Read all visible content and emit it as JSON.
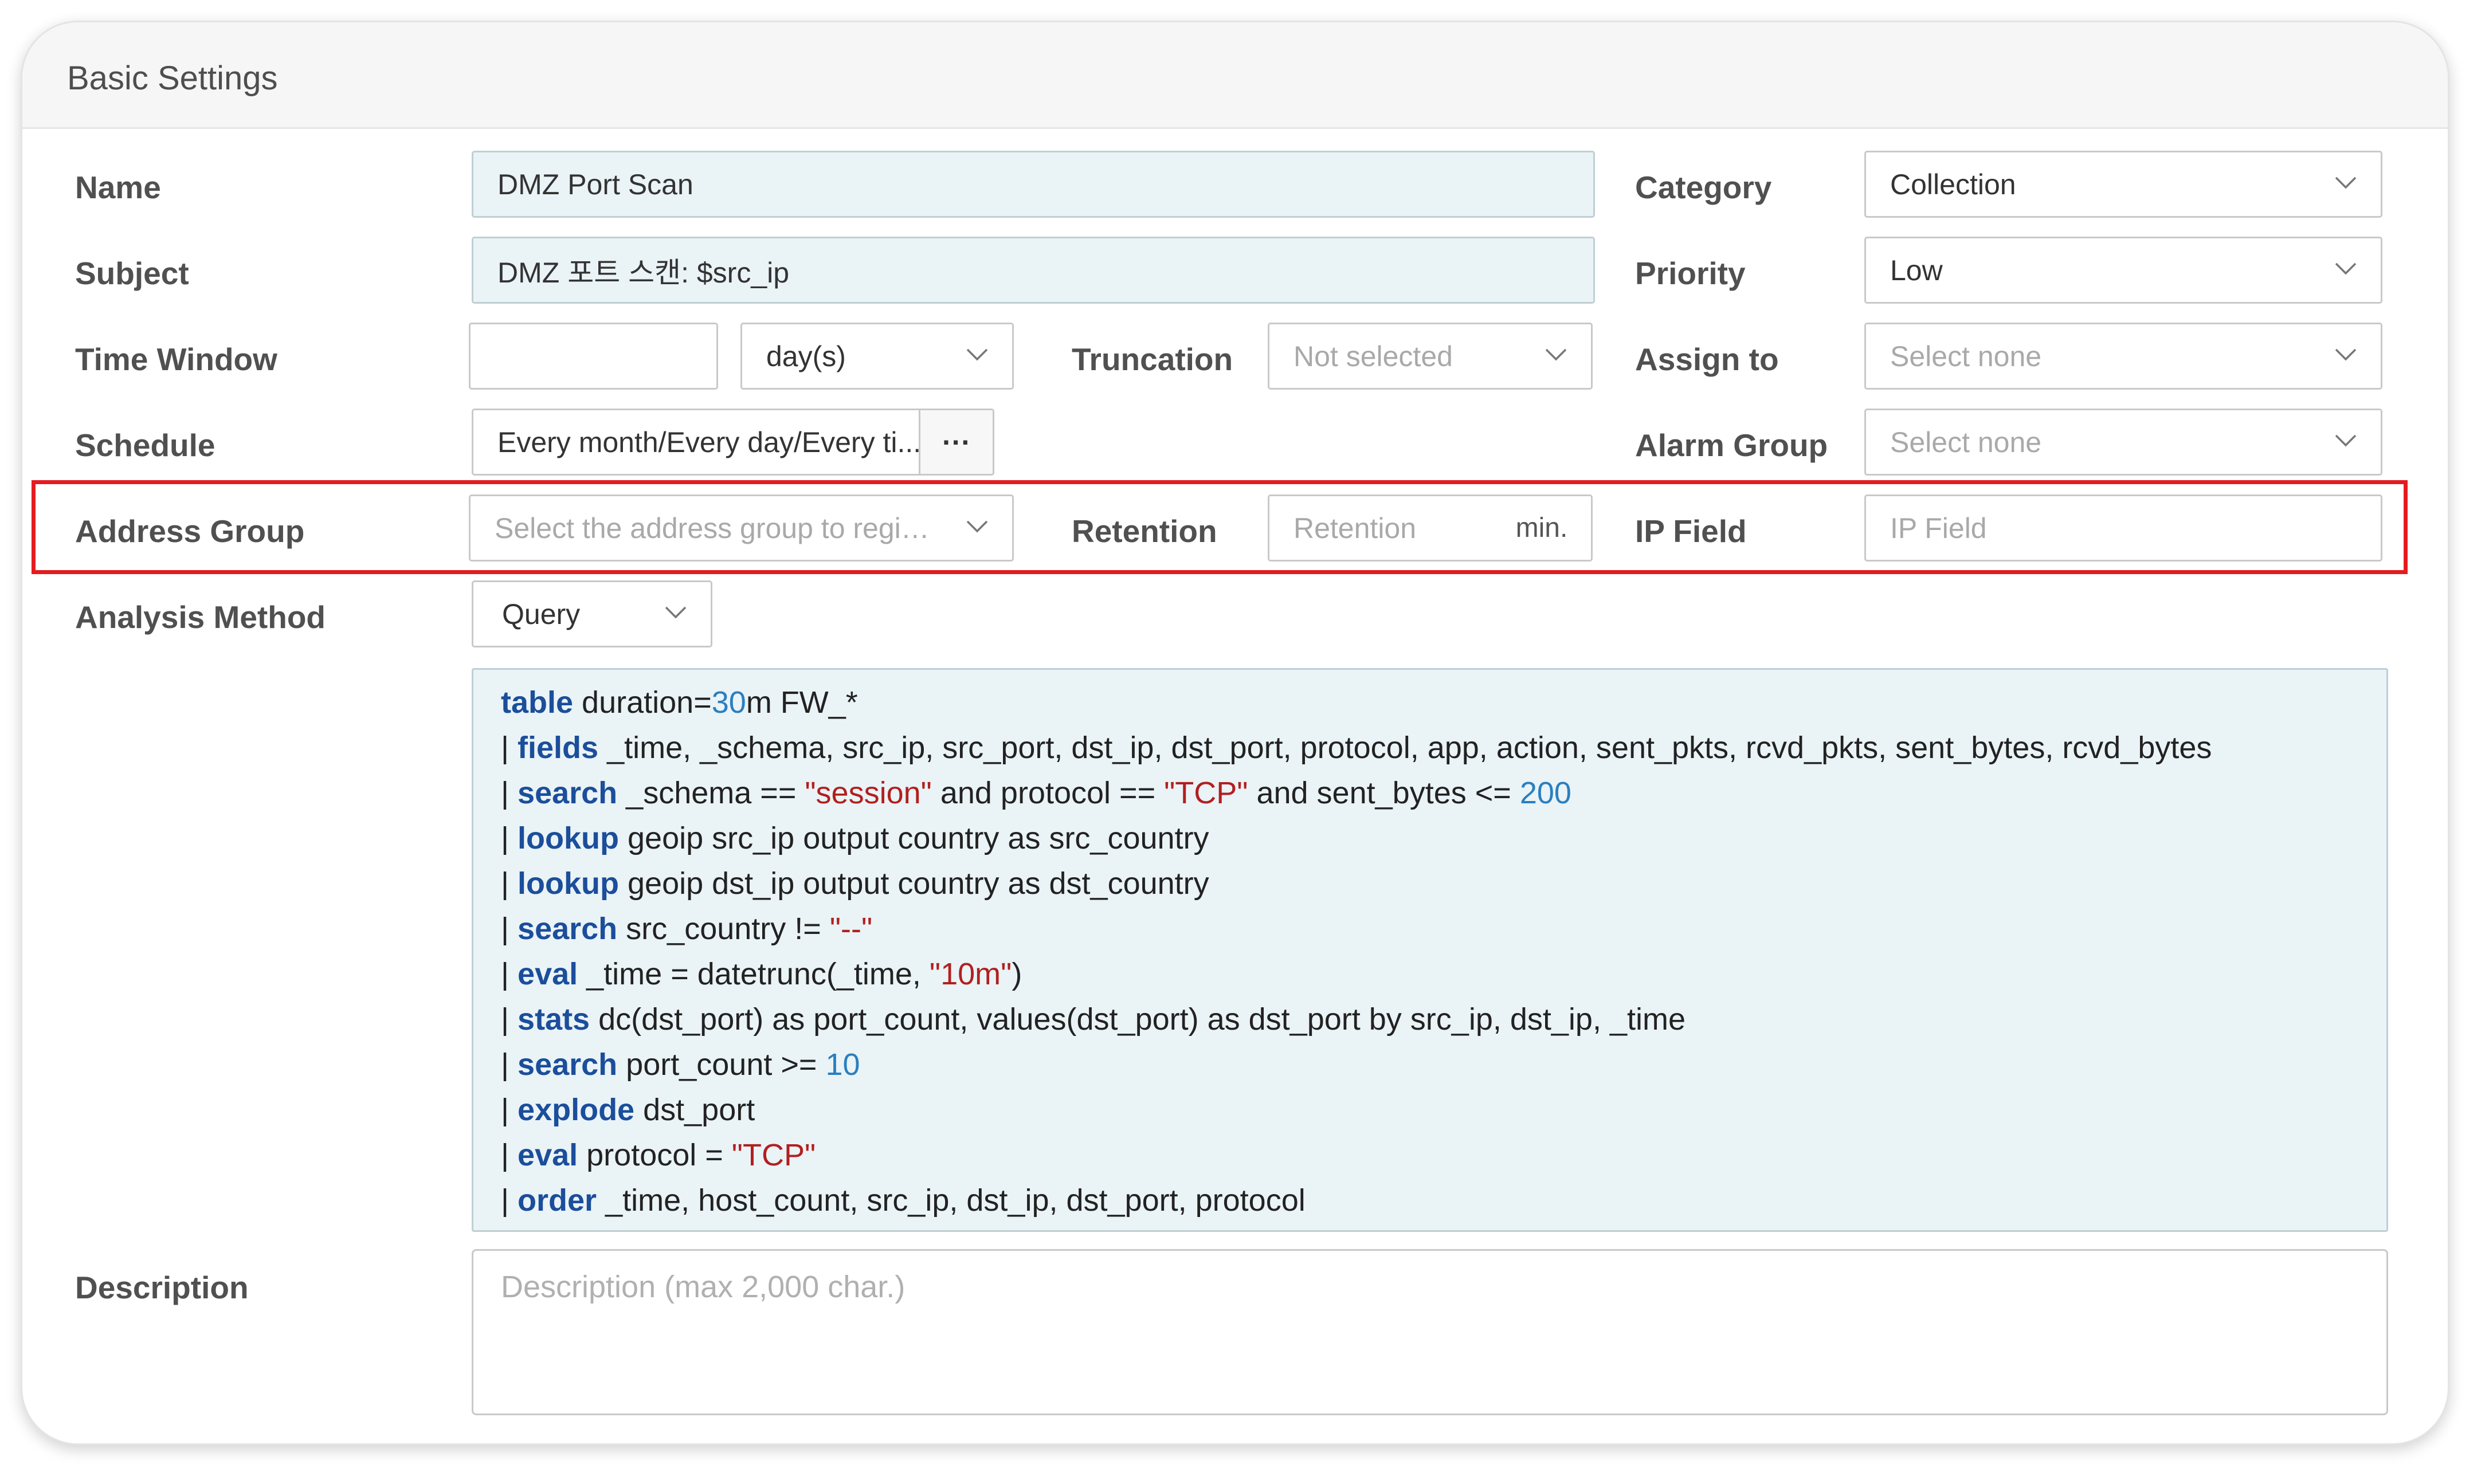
{
  "panel": {
    "title": "Basic Settings"
  },
  "labels": {
    "name": "Name",
    "subject": "Subject",
    "time_window": "Time Window",
    "schedule": "Schedule",
    "address_group": "Address Group",
    "analysis_method": "Analysis Method",
    "description": "Description",
    "truncation": "Truncation",
    "retention": "Retention",
    "category": "Category",
    "priority": "Priority",
    "assign_to": "Assign to",
    "alarm_group": "Alarm Group",
    "ip_field": "IP Field"
  },
  "fields": {
    "name_value": "DMZ Port Scan",
    "subject_value": "DMZ 포트 스캔: $src_ip",
    "time_window_value": "",
    "time_unit": "day(s)",
    "truncation_value": "Not selected",
    "schedule_value": "Every month/Every day/Every ti...",
    "schedule_button": "···",
    "address_group_placeholder": "Select the address group to register ...",
    "retention_placeholder": "Retention",
    "retention_unit": "min.",
    "category_value": "Collection",
    "priority_value": "Low",
    "assign_to_placeholder": "Select none",
    "alarm_group_placeholder": "Select none",
    "ip_field_placeholder": "IP Field",
    "analysis_method_value": "Query",
    "description_placeholder": "Description (max 2,000 char.)"
  },
  "query_lines": [
    [
      {
        "t": "table",
        "c": "kw"
      },
      {
        "t": " duration="
      },
      {
        "t": "30",
        "c": "num"
      },
      {
        "t": "m FW_*"
      }
    ],
    [
      {
        "t": "| "
      },
      {
        "t": "fields",
        "c": "kw"
      },
      {
        "t": " _time, _schema, src_ip, src_port, dst_ip, dst_port, protocol, app, action, sent_pkts, rcvd_pkts, sent_bytes, rcvd_bytes"
      }
    ],
    [
      {
        "t": "| "
      },
      {
        "t": "search",
        "c": "kw"
      },
      {
        "t": " _schema == "
      },
      {
        "t": "\"session\"",
        "c": "str"
      },
      {
        "t": " and protocol == "
      },
      {
        "t": "\"TCP\"",
        "c": "str"
      },
      {
        "t": " and sent_bytes <= "
      },
      {
        "t": "200",
        "c": "num"
      }
    ],
    [
      {
        "t": "| "
      },
      {
        "t": "lookup",
        "c": "kw"
      },
      {
        "t": " geoip src_ip output country as src_country"
      }
    ],
    [
      {
        "t": "| "
      },
      {
        "t": "lookup",
        "c": "kw"
      },
      {
        "t": " geoip dst_ip output country as dst_country"
      }
    ],
    [
      {
        "t": "| "
      },
      {
        "t": "search",
        "c": "kw"
      },
      {
        "t": " src_country != "
      },
      {
        "t": "\"--\"",
        "c": "str"
      }
    ],
    [
      {
        "t": "| "
      },
      {
        "t": "eval",
        "c": "kw"
      },
      {
        "t": " _time = datetrunc(_time, "
      },
      {
        "t": "\"10m\"",
        "c": "str"
      },
      {
        "t": ")"
      }
    ],
    [
      {
        "t": "| "
      },
      {
        "t": "stats",
        "c": "kw"
      },
      {
        "t": " dc(dst_port) as port_count, values(dst_port) as dst_port by src_ip, dst_ip, _time"
      }
    ],
    [
      {
        "t": "| "
      },
      {
        "t": "search",
        "c": "kw"
      },
      {
        "t": " port_count >= "
      },
      {
        "t": "10",
        "c": "num"
      }
    ],
    [
      {
        "t": "| "
      },
      {
        "t": "explode",
        "c": "kw"
      },
      {
        "t": " dst_port"
      }
    ],
    [
      {
        "t": "| "
      },
      {
        "t": "eval",
        "c": "kw"
      },
      {
        "t": " protocol = "
      },
      {
        "t": "\"TCP\"",
        "c": "str"
      }
    ],
    [
      {
        "t": "| "
      },
      {
        "t": "order",
        "c": "kw"
      },
      {
        "t": " _time, host_count, src_ip, dst_ip, dst_port, protocol"
      }
    ]
  ],
  "colors": {
    "highlight_border": "#e51b20",
    "keyword": "#1b4e9b",
    "string": "#b21f1f",
    "number": "#2a7fbf",
    "filled_field_bg": "#eaf3f6"
  }
}
